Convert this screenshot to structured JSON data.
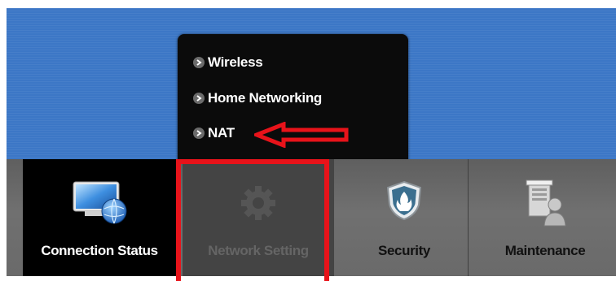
{
  "menu": {
    "items": [
      {
        "label": "Wireless"
      },
      {
        "label": "Home Networking"
      },
      {
        "label": "NAT"
      }
    ]
  },
  "nav": {
    "tabs": [
      {
        "label": "Connection Status",
        "icon": "monitor-globe-icon",
        "state": "normal"
      },
      {
        "label": "Network Setting",
        "icon": "gear-icon",
        "state": "active"
      },
      {
        "label": "Security",
        "icon": "shield-flame-icon",
        "state": "normal"
      },
      {
        "label": "Maintenance",
        "icon": "server-user-icon",
        "state": "normal"
      }
    ]
  },
  "annotations": {
    "highlight_color": "#e8131a"
  },
  "colors": {
    "banner": "#3c77c6",
    "menu_bg": "#0b0b0b",
    "nav_bg": "#6a6a6a",
    "active_tab": "#444444"
  }
}
